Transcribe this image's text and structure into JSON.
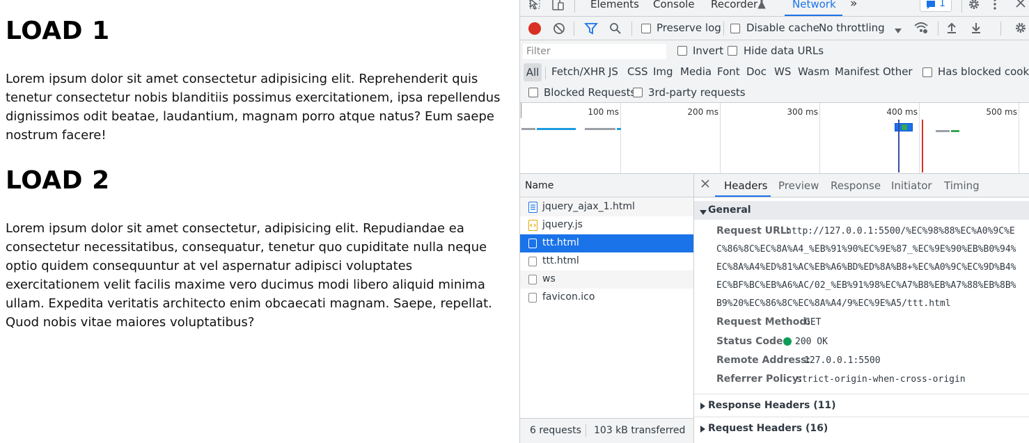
{
  "page": {
    "heading1": "LOAD 1",
    "para1_lines": [
      "Lorem ipsum dolor sit amet consectetur adipisicing elit. Reprehenderit quis",
      "tenetur consectetur nobis blanditiis possimus exercitationem, ipsa repellendus",
      "dignissimos odit beatae, laudantium, magnam porro atque natus? Eum saepe",
      "nostrum facere!"
    ],
    "heading2": "LOAD 2",
    "para2_lines": [
      "Lorem ipsum dolor sit amet consectetur, adipisicing elit. Repudiandae ea",
      "consectetur necessitatibus, consequatur, tenetur quo cupiditate nulla neque",
      "optio quidem consequuntur at vel aspernatur adipisci voluptates",
      "exercitationem velit facilis maxime vero ducimus modi libero aliquid minima",
      "ullam. Expedita veritatis architecto enim obcaecati magnam. Saepe, repellat.",
      "Quod nobis vitae maiores voluptatibus?"
    ]
  },
  "devtools": {
    "tabs": [
      "Elements",
      "Console",
      "Recorder",
      "Network"
    ],
    "active_tab": "Network",
    "more_tabs": "»",
    "issues_count": "1",
    "toolbar": {
      "preserve_log": "Preserve log",
      "disable_cache": "Disable cache",
      "throttling": "No throttling"
    },
    "filter": {
      "placeholder": "Filter",
      "invert": "Invert",
      "hide_data_urls": "Hide data URLs"
    },
    "type_filters": [
      "All",
      "Fetch/XHR",
      "JS",
      "CSS",
      "Img",
      "Media",
      "Font",
      "Doc",
      "WS",
      "Wasm",
      "Manifest",
      "Other"
    ],
    "has_blocked_cookies": "Has blocked cookies",
    "blocked_requests": "Blocked Requests",
    "third_party": "3rd-party requests",
    "overview_ticks": [
      "100 ms",
      "200 ms",
      "300 ms",
      "400 ms",
      "500 ms"
    ],
    "name_header": "Name",
    "requests": [
      {
        "name": "jquery_ajax_1.html",
        "icon": "document-icon"
      },
      {
        "name": "jquery.js",
        "icon": "script-icon"
      },
      {
        "name": "ttt.html",
        "icon": "blank-icon",
        "selected": true
      },
      {
        "name": "ttt.html",
        "icon": "blank-icon"
      },
      {
        "name": "ws",
        "icon": "blank-icon"
      },
      {
        "name": "favicon.ico",
        "icon": "blank-icon"
      }
    ],
    "status": {
      "requests": "6 requests",
      "transferred": "103 kB transferred"
    },
    "detail_tabs": [
      "Headers",
      "Preview",
      "Response",
      "Initiator",
      "Timing"
    ],
    "active_detail_tab": "Headers",
    "general": {
      "title": "General",
      "request_url_label": "Request URL:",
      "request_url_lines": [
        "http://127.0.0.1:5500/%EC%98%88%EC%A0%9C%E",
        "C%86%8C%EC%8A%A4_%EB%91%90%EC%9E%87_%EC%9E%90%EB%B0%94%",
        "EC%8A%A4%ED%81%AC%EB%A6%BD%ED%8A%B8+%EC%A0%9C%EC%9D%B4%",
        "EC%BF%BC%EB%A6%AC/02_%EB%91%98%EC%A7%B8%EB%A7%88%EB%8B%",
        "B9%20%EC%86%8C%EC%8A%A4/9%EC%9E%A5/ttt.html"
      ],
      "request_method_label": "Request Method:",
      "request_method": "GET",
      "status_code_label": "Status Code:",
      "status_code": "200 OK",
      "remote_address_label": "Remote Address:",
      "remote_address": "127.0.0.1:5500",
      "referrer_policy_label": "Referrer Policy:",
      "referrer_policy": "strict-origin-when-cross-origin"
    },
    "response_headers": "Response Headers (11)",
    "request_headers": "Request Headers (16)"
  },
  "colors": {
    "accent": "#1a73e8",
    "record_red": "#d93025",
    "status_green": "#0f9d58"
  }
}
